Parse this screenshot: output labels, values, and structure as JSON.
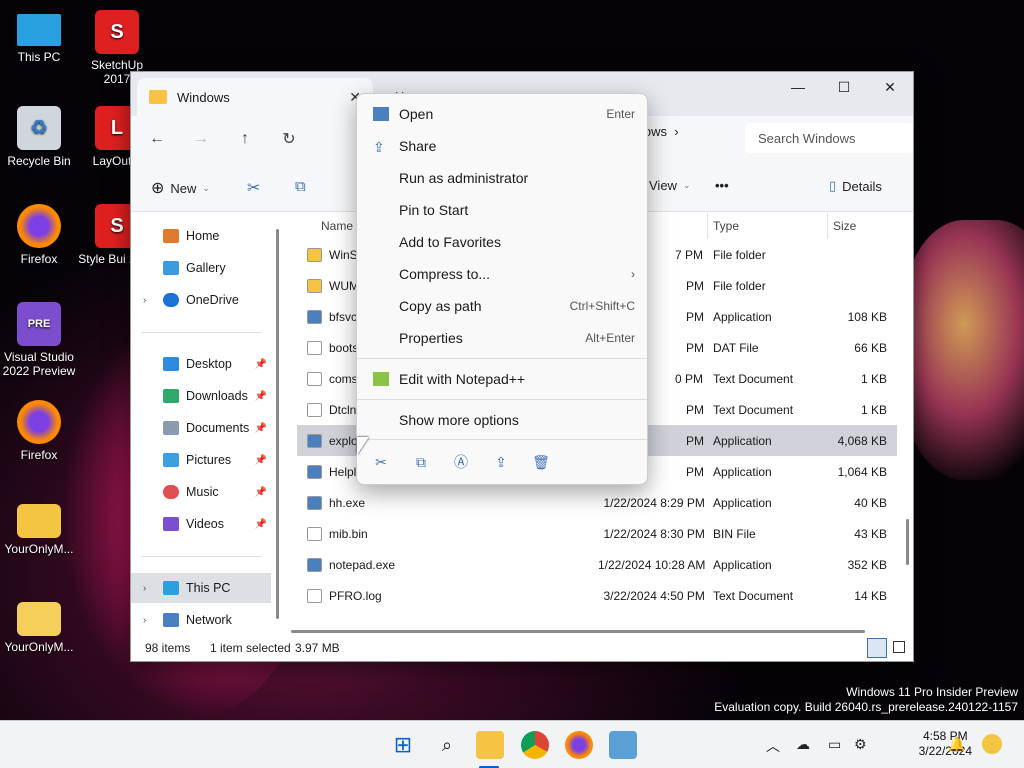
{
  "desktop": {
    "icons": [
      {
        "label": "This PC",
        "icon": "monitor-icon"
      },
      {
        "label": "SketchUp 2017",
        "icon": "sketchup-icon"
      },
      {
        "label": "Recycle Bin",
        "icon": "recycle-bin-icon"
      },
      {
        "label": "LayOut 2",
        "icon": "layout-icon"
      },
      {
        "label": "Firefox",
        "icon": "firefox-icon"
      },
      {
        "label": "Style Bui 2017",
        "icon": "style-builder-icon"
      },
      {
        "label": "Visual Studio 2022 Preview",
        "icon": "visual-studio-icon"
      },
      {
        "label": "Firefox",
        "icon": "firefox-icon"
      },
      {
        "label": "YourOnlyM...",
        "icon": "zip-folder-icon"
      },
      {
        "label": "YourOnlyM...",
        "icon": "folder-icon"
      }
    ]
  },
  "explorer": {
    "tab_title": "Windows",
    "tab2_title": "H",
    "breadcrumb_tail": "lows",
    "search_placeholder": "Search Windows",
    "toolbar": {
      "new_label": "New",
      "view_label": "View",
      "more_label": "•••",
      "details_label": "Details"
    },
    "sidebar": {
      "items": [
        {
          "label": "Home"
        },
        {
          "label": "Gallery"
        },
        {
          "label": "OneDrive"
        },
        {
          "label": "Desktop"
        },
        {
          "label": "Downloads"
        },
        {
          "label": "Documents"
        },
        {
          "label": "Pictures"
        },
        {
          "label": "Music"
        },
        {
          "label": "Videos"
        },
        {
          "label": "This PC"
        },
        {
          "label": "Network"
        }
      ]
    },
    "columns": {
      "name": "Name",
      "type": "Type",
      "size": "Size"
    },
    "files": [
      {
        "name": "WinS",
        "date": "7 PM",
        "type": "File folder",
        "size": ""
      },
      {
        "name": "WUM",
        "date": "PM",
        "type": "File folder",
        "size": ""
      },
      {
        "name": "bfsvc",
        "date": "PM",
        "type": "Application",
        "size": "108 KB"
      },
      {
        "name": "boots",
        "date": "PM",
        "type": "DAT File",
        "size": "66 KB"
      },
      {
        "name": "coms",
        "date": "0 PM",
        "type": "Text Document",
        "size": "1 KB"
      },
      {
        "name": "Dtcln",
        "date": "PM",
        "type": "Text Document",
        "size": "1 KB"
      },
      {
        "name": "explo",
        "date": "PM",
        "type": "Application",
        "size": "4,068 KB"
      },
      {
        "name": "Helpl",
        "date": "PM",
        "type": "Application",
        "size": "1,064 KB"
      },
      {
        "name": "hh.exe",
        "date": "1/22/2024 8:29 PM",
        "type": "Application",
        "size": "40 KB"
      },
      {
        "name": "mib.bin",
        "date": "1/22/2024 8:30 PM",
        "type": "BIN File",
        "size": "43 KB"
      },
      {
        "name": "notepad.exe",
        "date": "1/22/2024 10:28 AM",
        "type": "Application",
        "size": "352 KB"
      },
      {
        "name": "PFRO.log",
        "date": "3/22/2024 4:50 PM",
        "type": "Text Document",
        "size": "14 KB"
      }
    ],
    "status": {
      "count": "98 items",
      "selected": "1 item selected",
      "size": "3.97 MB"
    }
  },
  "context_menu": {
    "items": [
      {
        "label": "Open",
        "shortcut": "Enter"
      },
      {
        "label": "Share",
        "shortcut": ""
      },
      {
        "label": "Run as administrator",
        "shortcut": ""
      },
      {
        "label": "Pin to Start",
        "shortcut": ""
      },
      {
        "label": "Add to Favorites",
        "shortcut": ""
      },
      {
        "label": "Compress to...",
        "shortcut": "›"
      },
      {
        "label": "Copy as path",
        "shortcut": "Ctrl+Shift+C"
      },
      {
        "label": "Properties",
        "shortcut": "Alt+Enter"
      },
      {
        "label": "Edit with Notepad++",
        "shortcut": ""
      },
      {
        "label": "Show more options",
        "shortcut": ""
      }
    ]
  },
  "watermark": {
    "line1": "Windows 11 Pro Insider Preview",
    "line2": "Evaluation copy. Build 26040.rs_prerelease.240122-1157"
  },
  "taskbar": {
    "time": "4:58 PM",
    "date": "3/22/2024"
  }
}
